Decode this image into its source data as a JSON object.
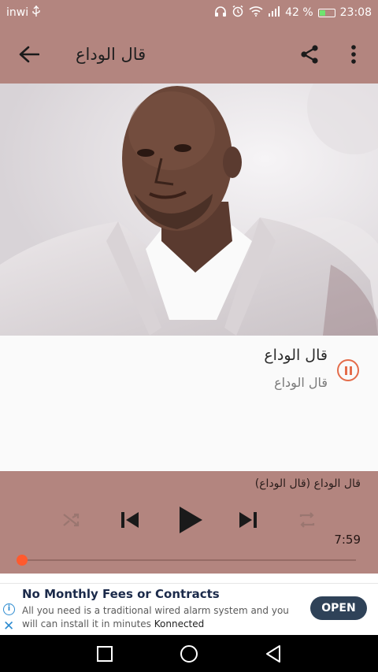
{
  "status_bar": {
    "carrier": "inwi",
    "usb_icon": "usb-icon",
    "battery_percent": "42 %",
    "battery_level": 0.42,
    "time": "23:08"
  },
  "app_bar": {
    "title": "قال الوداع",
    "back_icon": "arrow-left-icon",
    "share_icon": "share-icon",
    "menu_icon": "more-vert-icon"
  },
  "artwork": {
    "description_icon": "album-art"
  },
  "track": {
    "title": "قال الوداع",
    "subtitle": "قال الوداع",
    "state_icon": "pause-circle-icon"
  },
  "player": {
    "now_playing": "قال الوداع (قال الوداع)",
    "time": "7:59",
    "progress": 0.0,
    "icons": [
      "shuffle-icon",
      "skip-previous-icon",
      "play-icon",
      "skip-next-icon",
      "repeat-icon"
    ]
  },
  "ad": {
    "headline": "No Monthly Fees or Contracts",
    "body": "All you need is a traditional wired alarm system and you will can install it in minutes",
    "brand": "Konnected",
    "cta": "OPEN"
  },
  "colors": {
    "primary": "#b3857f",
    "accent": "#ff5a2e",
    "ad_button": "#2f4258"
  }
}
